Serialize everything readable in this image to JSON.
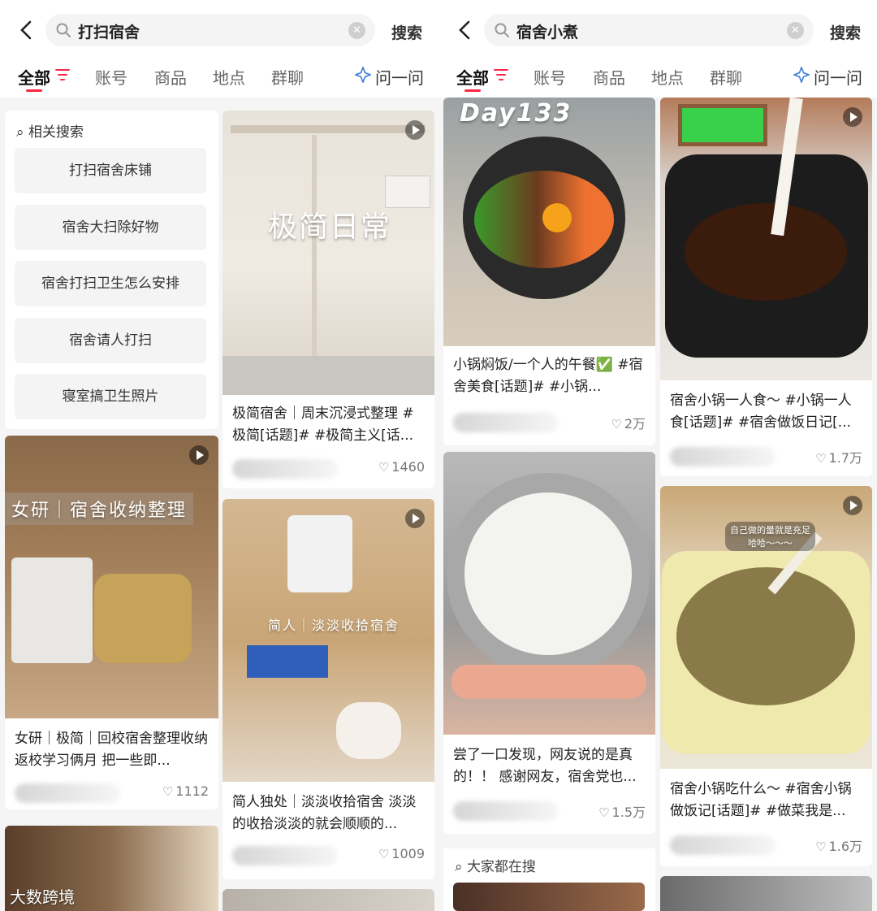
{
  "accent": "#ff2442",
  "left": {
    "query": "打扫宿舍",
    "search_button": "搜索",
    "tabs": [
      "全部",
      "账号",
      "商品",
      "地点",
      "群聊"
    ],
    "ask_label": "问一问",
    "related": {
      "heading": "相关搜索",
      "items": [
        "打扫宿舍床铺",
        "宿舍大扫除好物",
        "宿舍打扫卫生怎么安排",
        "宿舍请人打扫",
        "寝室搞卫生照片"
      ]
    },
    "notes": [
      {
        "overlay": "极简日常",
        "title": "极简宿舍｜周末沉浸式整理 #极简[话题]# #极简主义[话...",
        "likes": "1460"
      },
      {
        "overlay": "女研｜宿舍收纳整理",
        "title": "女研｜极简｜回校宿舍整理收纳 返校学习俩月 把一些即...",
        "likes": "1112"
      },
      {
        "overlay": "简人｜淡淡收拾宿舍",
        "title": "简人独处｜淡淡收拾宿舍 淡淡的收拾淡淡的就会顺顺的...",
        "likes": "1009"
      }
    ]
  },
  "right": {
    "query": "宿舍小煮",
    "search_button": "搜索",
    "tabs": [
      "全部",
      "账号",
      "商品",
      "地点",
      "群聊"
    ],
    "ask_label": "问一问",
    "notes": [
      {
        "overlay": "Day133",
        "title": "小锅焖饭/一个人的午餐✅ #宿舍美食[话题]# #小锅...",
        "likes": "2万"
      },
      {
        "title": "宿舍小锅一人食～ #小锅一人食[话题]# #宿舍做饭日记[...",
        "likes": "1.7万"
      },
      {
        "title": "尝了一口发现，网友说的是真的！！ 感谢网友，宿舍党也...",
        "likes": "1.5万"
      },
      {
        "overlay": "自己做的量就是充足\n哈哈～～～",
        "title": "宿舍小锅吃什么～ #宿舍小锅做饭记[话题]# #做菜我是...",
        "likes": "1.6万"
      }
    ],
    "everyone_searching": "大家都在搜"
  },
  "watermark": "大数跨境"
}
